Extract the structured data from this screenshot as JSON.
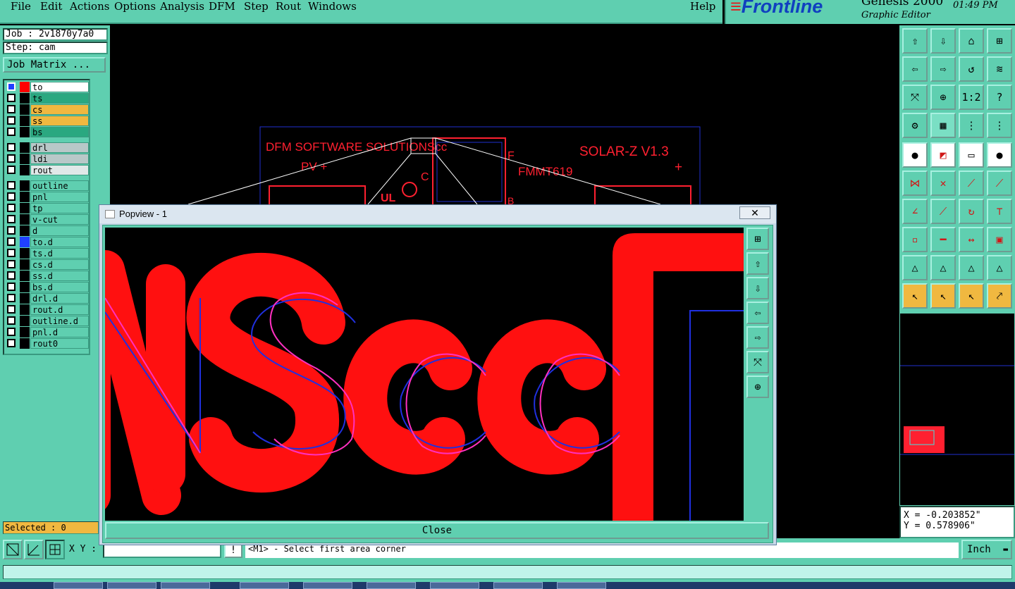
{
  "menu": {
    "file": "File",
    "edit": "Edit",
    "actions": "Actions",
    "options": "Options",
    "analysis": "Analysis",
    "dfm": "DFM",
    "step": "Step",
    "rout": "Rout",
    "windows": "Windows",
    "help": "Help"
  },
  "brand": {
    "logo": "Frontline",
    "product": "Genesis 2000",
    "subtitle": "Graphic Editor",
    "time": "01:49 PM"
  },
  "job": {
    "job_label": "Job : 2v1870y7a0",
    "step_label": "Step: cam",
    "job_matrix": "Job Matrix ..."
  },
  "layers": [
    {
      "name": "to",
      "color": "#ff0000",
      "bg": "#ffffff",
      "active": true
    },
    {
      "name": "ts",
      "color": "#000000",
      "bg": "#2aa880"
    },
    {
      "name": "cs",
      "color": "#000000",
      "bg": "#f0b840"
    },
    {
      "name": "ss",
      "color": "#000000",
      "bg": "#f0b840"
    },
    {
      "name": "bs",
      "color": "#000000",
      "bg": "#2aa880"
    },
    {
      "name": "drl",
      "color": "#000000",
      "bg": "#b8c8c8"
    },
    {
      "name": "ldi",
      "color": "#000000",
      "bg": "#b8c8c8"
    },
    {
      "name": "rout",
      "color": "#000000",
      "bg": "#e0e8e8"
    },
    {
      "name": "outline",
      "color": "#000000",
      "bg": "#5fcfb0"
    },
    {
      "name": "pnl",
      "color": "#000000",
      "bg": "#5fcfb0"
    },
    {
      "name": "tp",
      "color": "#000000",
      "bg": "#5fcfb0"
    },
    {
      "name": "v-cut",
      "color": "#000000",
      "bg": "#5fcfb0"
    },
    {
      "name": "d",
      "color": "#000000",
      "bg": "#5fcfb0"
    },
    {
      "name": "to.d",
      "color": "#2040ff",
      "bg": "#5fcfb0"
    },
    {
      "name": "ts.d",
      "color": "#000000",
      "bg": "#5fcfb0"
    },
    {
      "name": "cs.d",
      "color": "#000000",
      "bg": "#5fcfb0"
    },
    {
      "name": "ss.d",
      "color": "#000000",
      "bg": "#5fcfb0"
    },
    {
      "name": "bs.d",
      "color": "#000000",
      "bg": "#5fcfb0"
    },
    {
      "name": "drl.d",
      "color": "#000000",
      "bg": "#5fcfb0"
    },
    {
      "name": "rout.d",
      "color": "#000000",
      "bg": "#5fcfb0"
    },
    {
      "name": "outline.d",
      "color": "#000000",
      "bg": "#5fcfb0"
    },
    {
      "name": "pnl.d",
      "color": "#000000",
      "bg": "#5fcfb0"
    },
    {
      "name": "rout0",
      "color": "#000000",
      "bg": "#5fcfb0"
    }
  ],
  "selected": "Selected : 0",
  "board": {
    "text1": "DFM SOFTWARE SOLUTIONScc",
    "text2": "SOLAR-Z V1.3",
    "text3": "PV +",
    "text4": "FMMT619",
    "text5": "C",
    "text6": "F",
    "text7": "B",
    "text8": "+"
  },
  "popview": {
    "title": "Popview - 1",
    "close": "Close",
    "x": "✕"
  },
  "coords": {
    "x": "X = -0.203852\"",
    "y": "Y = 0.578906\""
  },
  "bottom": {
    "xy_label": "X Y :",
    "xy_value": "",
    "prompt": "<M1> - Select first area corner",
    "unit": "Inch"
  },
  "colors": {
    "panel": "#5fcfb0",
    "feature": "#ff0000",
    "outline": "#2030d0",
    "highlight": "#ff40c0"
  }
}
